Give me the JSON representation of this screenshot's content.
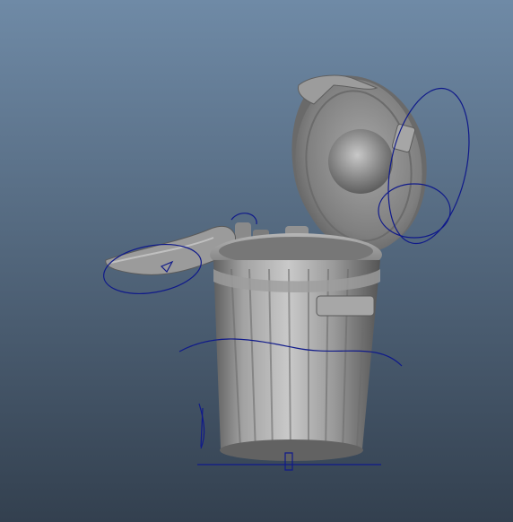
{
  "viewport": {
    "background_top": "#6f8aa6",
    "background_bottom": "#33404f",
    "model_color": "#8a8a8a",
    "rig_curve_color": "#101a8a"
  },
  "scene": {
    "model": "trash-can-with-lid-and-arm",
    "rig_controls_visible": true
  }
}
